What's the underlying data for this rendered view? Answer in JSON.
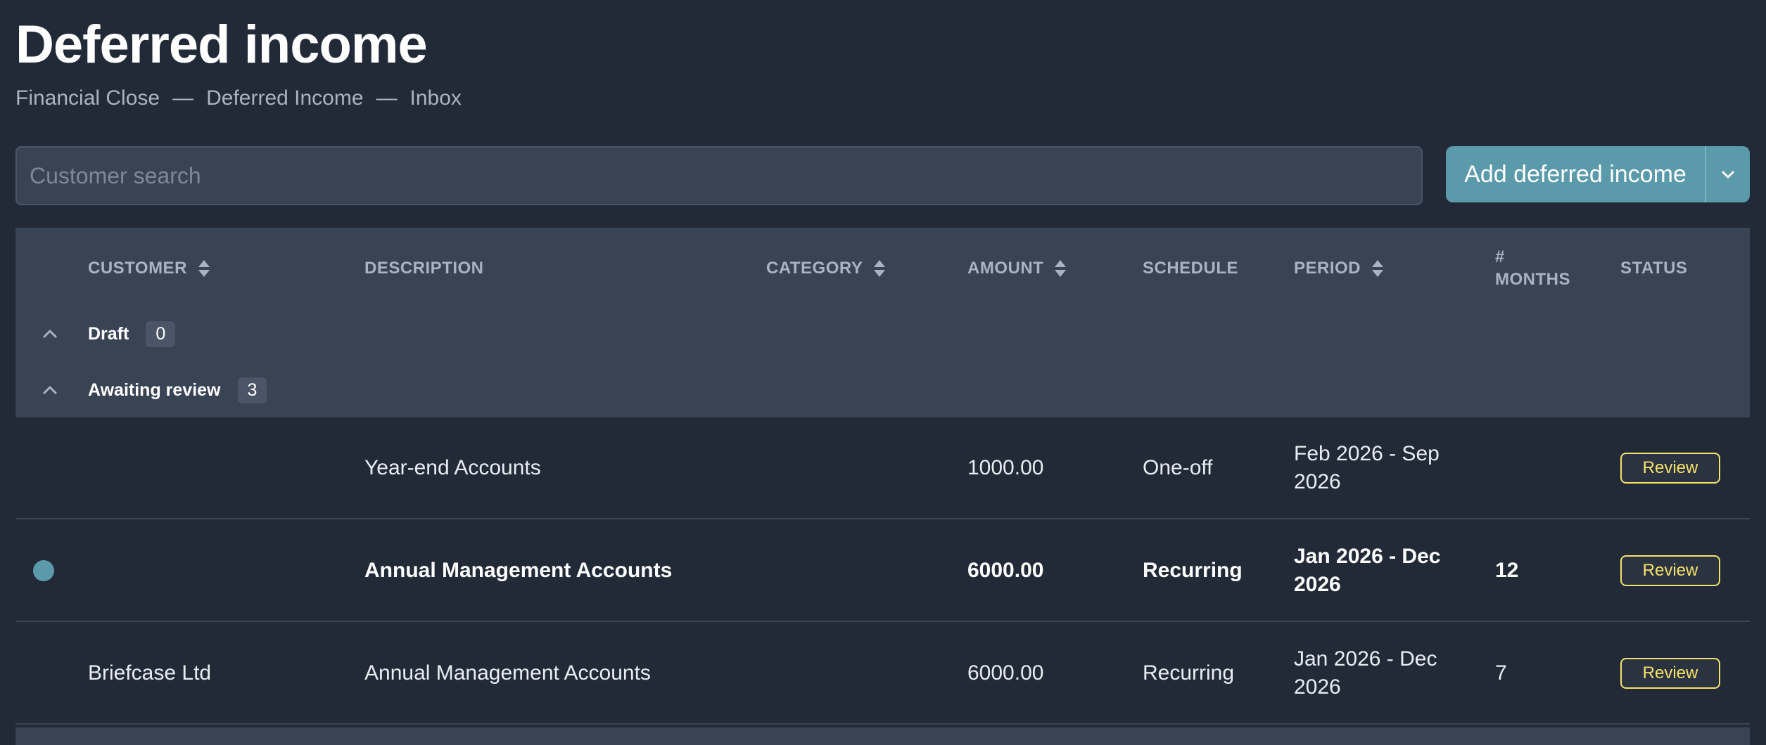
{
  "page": {
    "title": "Deferred income",
    "breadcrumb": [
      "Financial Close",
      "Deferred Income",
      "Inbox"
    ],
    "breadcrumb_separator": "—"
  },
  "search": {
    "placeholder": "Customer search",
    "value": ""
  },
  "actions": {
    "add_label": "Add deferred income"
  },
  "table": {
    "headers": {
      "customer": "CUSTOMER",
      "description": "DESCRIPTION",
      "category": "CATEGORY",
      "amount": "AMOUNT",
      "schedule": "SCHEDULE",
      "period": "PERIOD",
      "months_line1": "#",
      "months_line2": "MONTHS",
      "status": "STATUS"
    },
    "groups": [
      {
        "label": "Draft",
        "count": "0"
      },
      {
        "label": "Awaiting review",
        "count": "3"
      }
    ],
    "rows": [
      {
        "customer": "",
        "description": "Year-end Accounts",
        "category": "",
        "amount": "1000.00",
        "schedule": "One-off",
        "period_line1": "Feb 2026 - Sep",
        "period_line2": "2026",
        "months": "",
        "status": "Review"
      },
      {
        "customer": "",
        "description": "Annual Management Accounts",
        "category": "",
        "amount": "6000.00",
        "schedule": "Recurring",
        "period_line1": "Jan 2026 - Dec",
        "period_line2": "2026",
        "months": "12",
        "status": "Review"
      },
      {
        "customer": "Briefcase Ltd",
        "description": "Annual Management Accounts",
        "category": "",
        "amount": "6000.00",
        "schedule": "Recurring",
        "period_line1": "Jan 2026 - Dec",
        "period_line2": "2026",
        "months": "7",
        "status": "Review"
      }
    ]
  },
  "colors": {
    "background": "#222a38",
    "header_bg": "#384354",
    "accent": "#5a9aaa",
    "review": "#f5e26b"
  }
}
